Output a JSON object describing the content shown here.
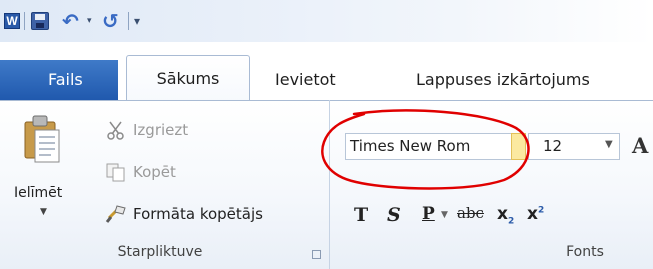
{
  "quick_access": {
    "app_icon": "word-app-icon",
    "save_icon": "save-icon",
    "undo_icon": "undo-icon",
    "redo_icon": "redo-icon",
    "dropdown_glyph": "▾",
    "customize_glyph": "▾"
  },
  "tabs": {
    "file": "Fails",
    "home": "Sākums",
    "insert": "Ievietot",
    "layout": "Lappuses izkārtojums"
  },
  "clipboard": {
    "paste": "Ielīmēt",
    "cut": "Izgriezt",
    "copy": "Kopēt",
    "format_painter": "Formāta kopētājs",
    "group_label": "Starpliktuve"
  },
  "font": {
    "font_name": "Times New Rom",
    "font_size": "12",
    "grow_font": "A",
    "bold": "T",
    "italic": "S",
    "underline": "P",
    "strike": "abc",
    "subscript": "x",
    "superscript": "x",
    "group_label": "Fonts"
  },
  "colors": {
    "file_tab": "#2b63b8",
    "annotation": "#e00000",
    "highlight": "#fbe9a0"
  }
}
